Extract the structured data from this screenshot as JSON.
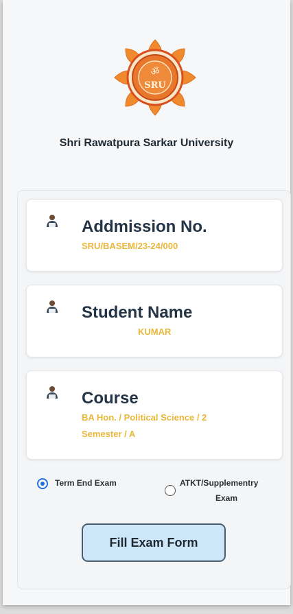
{
  "university": {
    "name": "Shri Rawatpura Sarkar University",
    "logo_text": "SRU"
  },
  "cards": [
    {
      "title": "Addmission No.",
      "value": "SRU/BASEM/23-24/000",
      "icon": "student-icon"
    },
    {
      "title": "Student Name",
      "value": "KUMAR",
      "icon": "student-icon"
    },
    {
      "title": "Course",
      "value_line1": "BA Hon. / Political Science / 2",
      "value_line2": "Semester / A",
      "icon": "student-icon"
    }
  ],
  "exam_type": {
    "options": [
      {
        "label": "Term End Exam",
        "selected": true
      },
      {
        "label_line1": "ATKT/Supplementry",
        "label_line2": "Exam",
        "selected": false
      }
    ]
  },
  "actions": {
    "fill_form_label": "Fill Exam Form"
  },
  "colors": {
    "accent_value": "#e9b73a",
    "button_bg": "#cde6f8",
    "radio_selected": "#1d6fe0",
    "logo_orange": "#e8762b"
  }
}
